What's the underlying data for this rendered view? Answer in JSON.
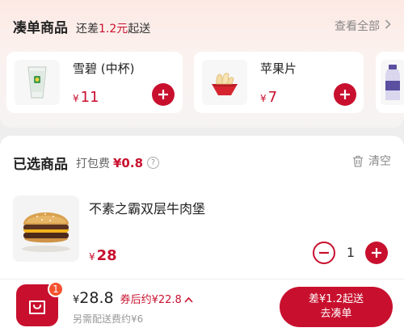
{
  "addon": {
    "title": "凑单商品",
    "sub_prefix": "还差",
    "sub_amount": "1.2",
    "sub_unit": "元",
    "sub_suffix": "起送",
    "view_all": "查看全部",
    "items": [
      {
        "name": "雪碧 (中杯)",
        "currency": "¥",
        "price": "11",
        "icon": "sprite-cup-image"
      },
      {
        "name": "苹果片",
        "currency": "¥",
        "price": "7",
        "icon": "apple-slices-image"
      }
    ]
  },
  "selected": {
    "title": "已选商品",
    "pack_label": "打包费",
    "pack_fee": "¥0.8",
    "help_icon": "?",
    "clear_label": "清空",
    "items": [
      {
        "name": "不素之霸双层牛肉堡",
        "currency": "¥",
        "price": "28",
        "quantity": "1",
        "icon": "burger-image"
      }
    ]
  },
  "bottom": {
    "badge_count": "1",
    "total_symbol": "¥",
    "total_value": "28.8",
    "coupon_text": "券后约¥22.8",
    "delivery_text": "另需配送费约¥6",
    "cta_line1": "差¥1.2起送",
    "cta_line2": "去凑单"
  },
  "colors": {
    "accent": "#c8102e",
    "badge": "#f5522e"
  }
}
